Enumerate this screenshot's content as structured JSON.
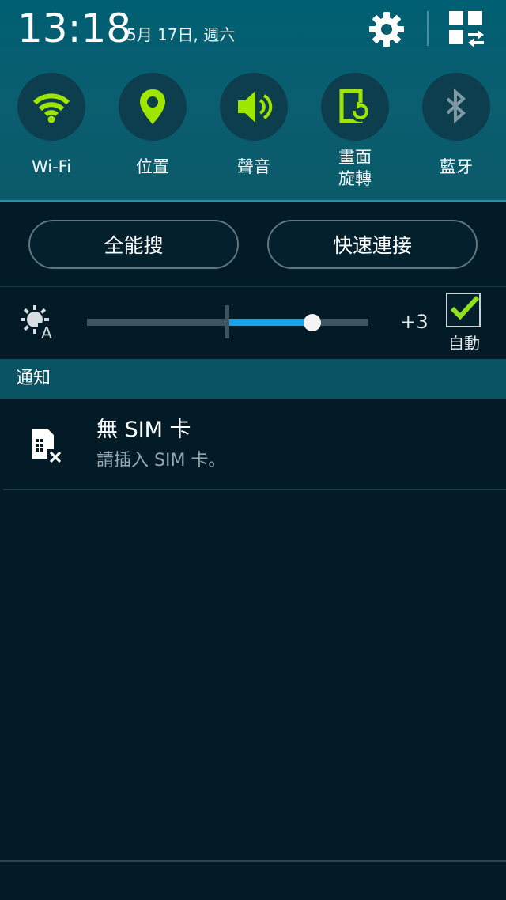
{
  "status": {
    "time": "13:18",
    "date": "5月 17日, 週六"
  },
  "header": {
    "settings_icon": "gear-icon",
    "edit_icon": "quick-settings-grid-icon"
  },
  "toggles": [
    {
      "label": "Wi-Fi",
      "icon": "wifi-icon",
      "state": "on"
    },
    {
      "label": "位置",
      "icon": "location-pin-icon",
      "state": "on"
    },
    {
      "label": "聲音",
      "icon": "speaker-icon",
      "state": "on"
    },
    {
      "label": "畫面\n旋轉",
      "icon": "screen-rotation-icon",
      "state": "on"
    },
    {
      "label": "藍牙",
      "icon": "bluetooth-icon",
      "state": "off"
    }
  ],
  "actions": {
    "search_label": "全能搜",
    "quick_connect_label": "快速連接"
  },
  "brightness": {
    "icon": "auto-brightness-icon",
    "level": 3,
    "min": -5,
    "max": 5,
    "value_text": "+3",
    "auto_checked": true,
    "auto_label": "自動"
  },
  "notifications": {
    "header": "通知",
    "items": [
      {
        "icon": "no-sim-icon",
        "title": "無 SIM 卡",
        "text": "請插入 SIM 卡。"
      }
    ]
  },
  "colors": {
    "header_bg": "#0a5e6f",
    "panel_bg": "#031b27",
    "toggle_on": "#9ee600",
    "toggle_off": "#6f8c96",
    "slider_fill": "#1aa3e8",
    "check": "#8fe31a",
    "notif_header_bg": "#0a5364"
  }
}
